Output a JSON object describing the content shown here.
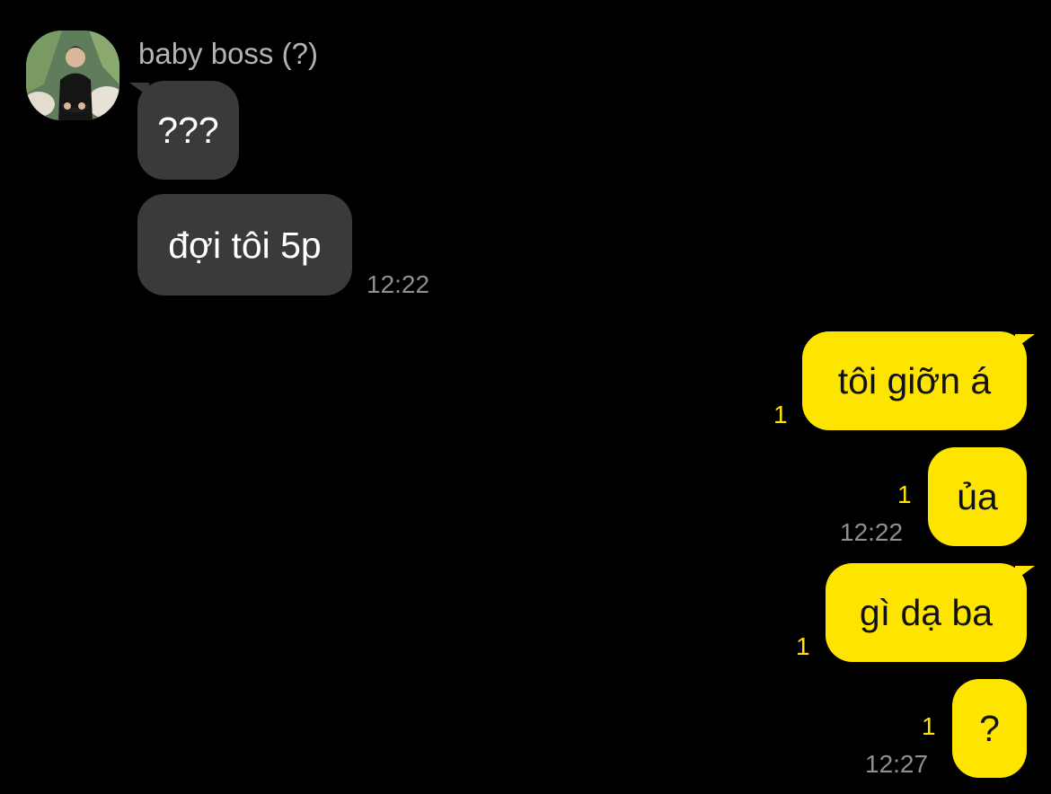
{
  "contact": {
    "name": "baby boss (?)",
    "avatar_icon": "profile-photo"
  },
  "incoming": [
    {
      "text": "???"
    },
    {
      "text": "đợi tôi 5p"
    }
  ],
  "incoming_time": "12:22",
  "outgoing": [
    {
      "text": "tôi giỡn á",
      "unread": "1"
    },
    {
      "text": "ủa",
      "unread": "1",
      "time": "12:22"
    },
    {
      "text": "gì dạ ba",
      "unread": "1"
    },
    {
      "text": "?",
      "unread": "1",
      "time": "12:27"
    }
  ],
  "colors": {
    "background": "#000000",
    "incoming_bubble": "#3a3a3c",
    "outgoing_bubble": "#fee500",
    "unread_count": "#fee500",
    "timestamp": "#8e8e93"
  }
}
